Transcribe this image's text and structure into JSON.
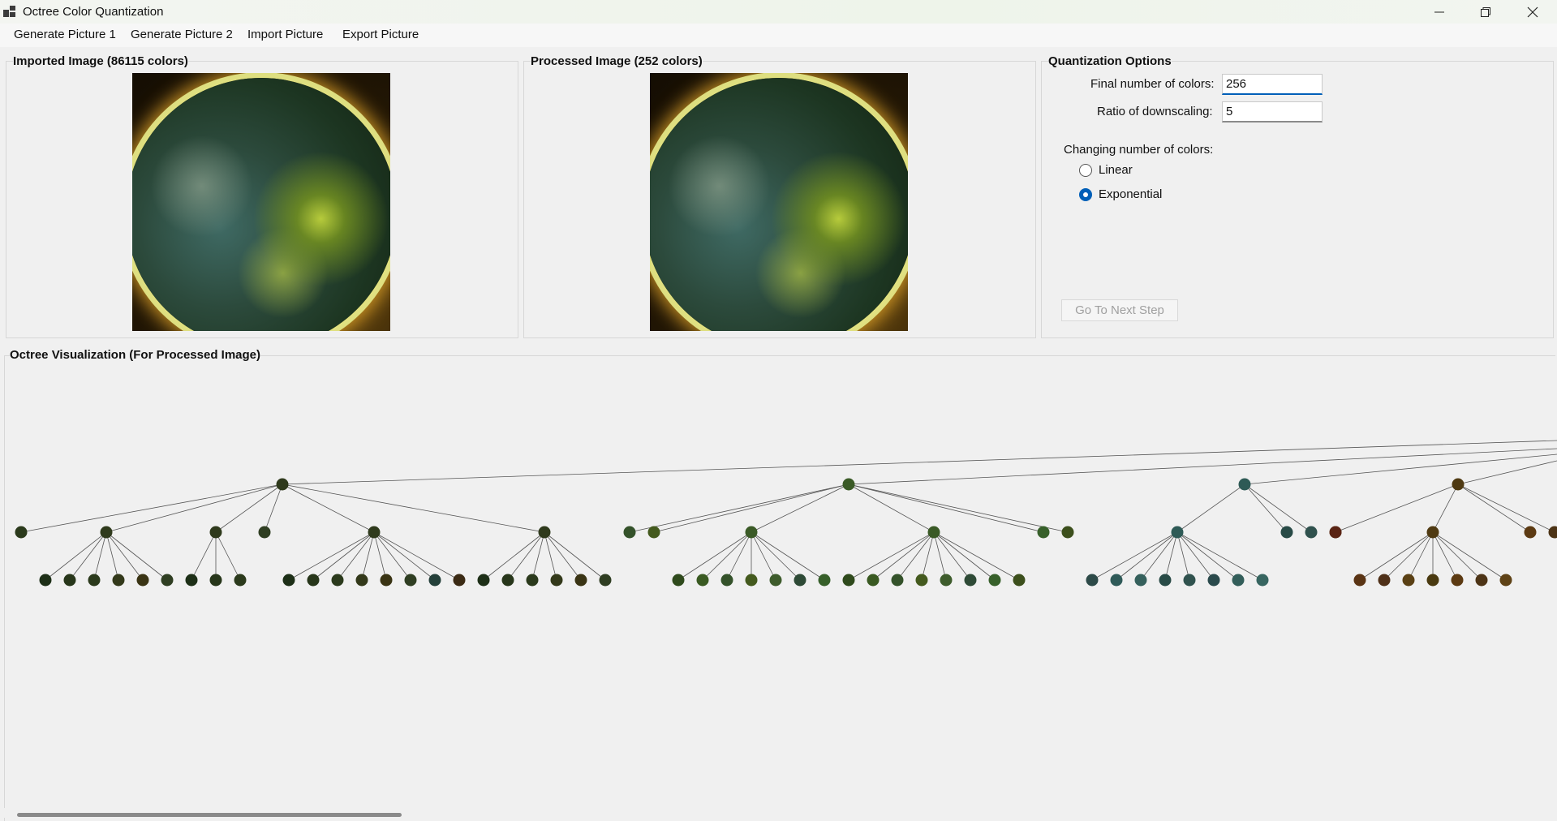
{
  "window": {
    "title": "Octree Color Quantization"
  },
  "menu": [
    "Generate Picture 1",
    "Generate Picture 2",
    "Import Picture",
    "Export Picture"
  ],
  "imported": {
    "title": "Imported Image (86115 colors)"
  },
  "processed": {
    "title": "Processed Image (252 colors)"
  },
  "options": {
    "title": "Quantization Options",
    "final_colors_label": "Final number of colors:",
    "final_colors_value": "256",
    "ratio_label": "Ratio of downscaling:",
    "ratio_value": "5",
    "changing_label": "Changing number of colors:",
    "linear_label": "Linear",
    "exponential_label": "Exponential",
    "selected_mode": "Exponential",
    "next_button": "Go To Next Step"
  },
  "octree": {
    "title": "Octree Visualization (For Processed Image)"
  },
  "node_colors": {
    "branch_dark": "#2f3a1c",
    "branch_green": "#3a5a26",
    "branch_teal": "#2e5a56",
    "branch_brown": "#4f3a12",
    "red": "#5a2414"
  }
}
